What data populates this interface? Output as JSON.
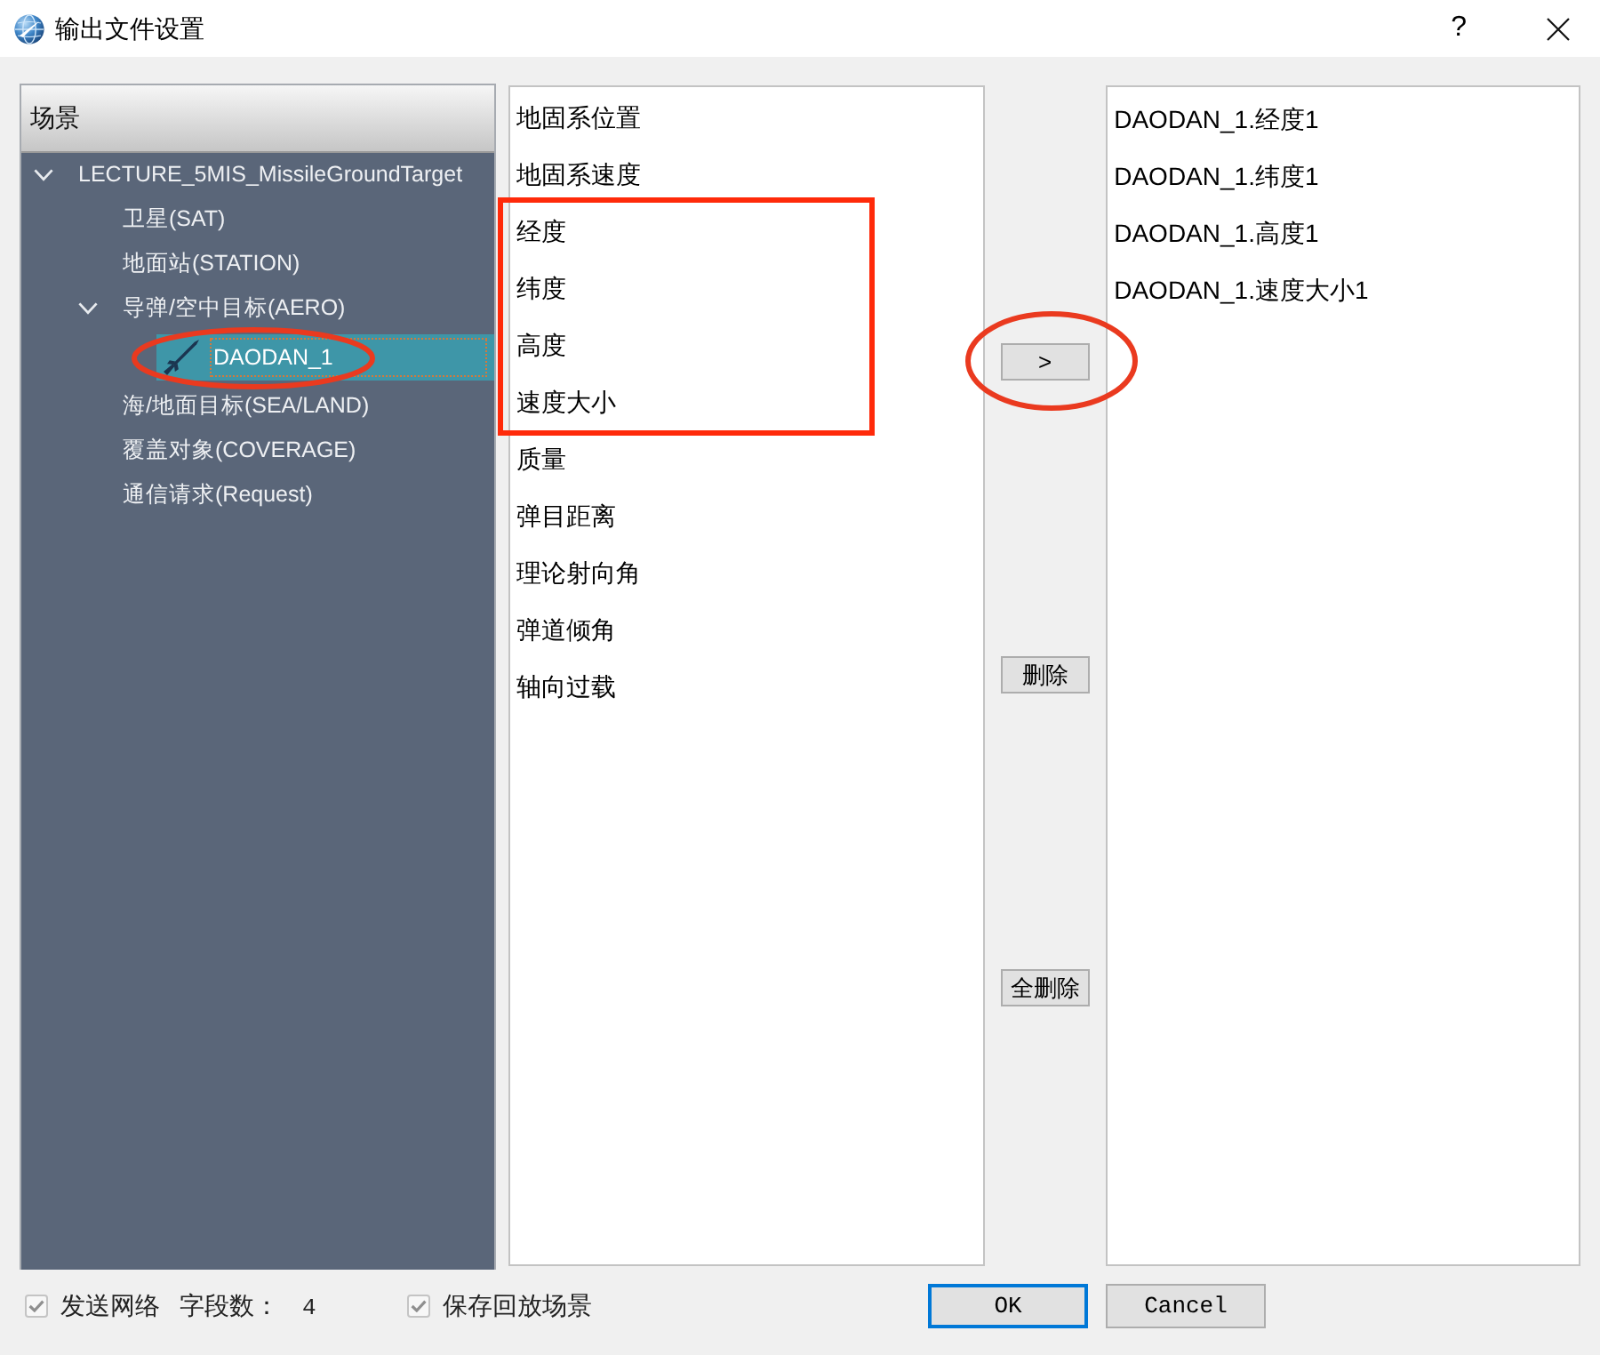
{
  "window": {
    "title": "输出文件设置",
    "help_button": "?"
  },
  "tree": {
    "header": "场景",
    "items": [
      {
        "label": "LECTURE_5MIS_MissileGroundTarget",
        "kind": "scenario",
        "expanded": true,
        "selected": false,
        "children": [
          {
            "label": "卫星(SAT)",
            "kind": "category",
            "selected": false
          },
          {
            "label": "地面站(STATION)",
            "kind": "category",
            "selected": false
          },
          {
            "label": "导弹/空中目标(AERO)",
            "kind": "category",
            "expanded": true,
            "selected": false,
            "children": [
              {
                "label": "DAODAN_1",
                "kind": "object",
                "selected": true,
                "circled": true
              }
            ]
          },
          {
            "label": "海/地面目标(SEA/LAND)",
            "kind": "category",
            "selected": false
          },
          {
            "label": "覆盖对象(COVERAGE)",
            "kind": "category",
            "selected": false
          },
          {
            "label": "通信请求(Request)",
            "kind": "category",
            "selected": false
          }
        ]
      }
    ]
  },
  "available_fields": [
    {
      "label": "地固系位置",
      "marked": false
    },
    {
      "label": "地固系速度",
      "marked": false
    },
    {
      "label": "经度",
      "marked": true
    },
    {
      "label": "纬度",
      "marked": true
    },
    {
      "label": "高度",
      "marked": true
    },
    {
      "label": "速度大小",
      "marked": true
    },
    {
      "label": "质量",
      "marked": false
    },
    {
      "label": "弹目距离",
      "marked": false
    },
    {
      "label": "理论射向角",
      "marked": false
    },
    {
      "label": "弹道倾角",
      "marked": false
    },
    {
      "label": "轴向过载",
      "marked": false
    }
  ],
  "transfer_buttons": [
    {
      "label": ">",
      "circled": true
    },
    {
      "label": "删除",
      "circled": false
    },
    {
      "label": "全删除",
      "circled": false
    }
  ],
  "output_fields": [
    {
      "label": "DAODAN_1.经度1"
    },
    {
      "label": "DAODAN_1.纬度1"
    },
    {
      "label": "DAODAN_1.高度1"
    },
    {
      "label": "DAODAN_1.速度大小1"
    }
  ],
  "options": {
    "send_network": {
      "label": "发送网络",
      "checked": true,
      "disabled": true
    },
    "field_count": {
      "label": "字段数：",
      "value": "4"
    },
    "save_playback": {
      "label": "保存回放场景",
      "checked": true,
      "disabled": true
    }
  },
  "buttons": [
    {
      "label": "OK",
      "default": true
    },
    {
      "label": "Cancel",
      "default": false
    }
  ]
}
